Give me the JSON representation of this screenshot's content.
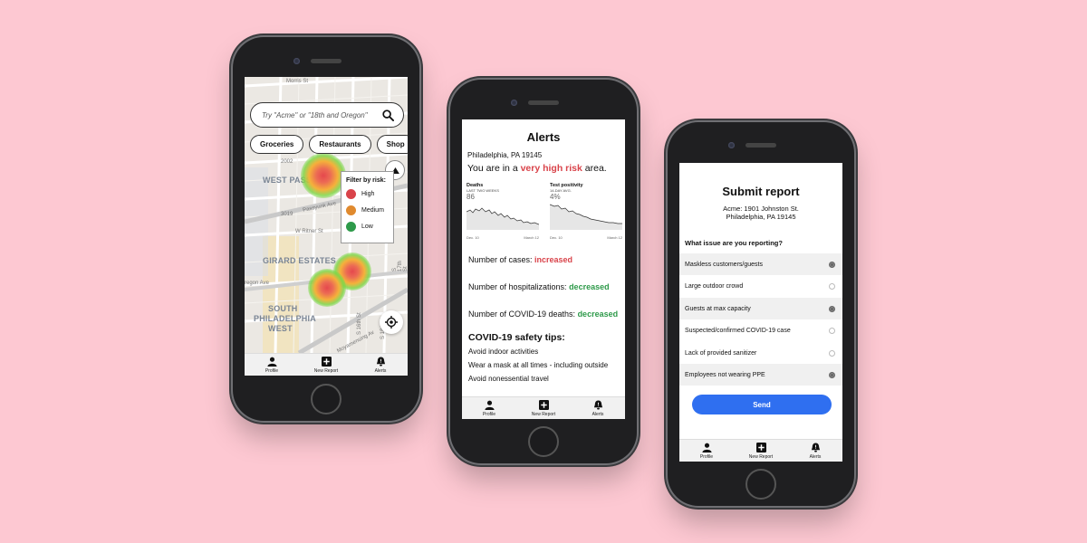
{
  "colors": {
    "background": "#fdc8d2",
    "risk_high": "#d9434a",
    "risk_medium": "#e08a2e",
    "risk_low": "#2e9a4a",
    "primary": "#2f6ff0"
  },
  "tabbar": [
    {
      "label": "Profile",
      "icon": "person-icon"
    },
    {
      "label": "New Report",
      "icon": "plus-square-icon"
    },
    {
      "label": "Alerts",
      "icon": "bell-alert-icon"
    }
  ],
  "map_screen": {
    "search": {
      "placeholder": "Try \"Acme\" or \"18th and Oregon\"",
      "icon": "search-icon"
    },
    "categories": [
      "Groceries",
      "Restaurants",
      "Shop"
    ],
    "filter": {
      "title": "Filter by risk:",
      "levels": [
        {
          "label": "High",
          "color": "#d9434a"
        },
        {
          "label": "Medium",
          "color": "#e08a2e"
        },
        {
          "label": "Low",
          "color": "#2e9a4a"
        }
      ]
    },
    "neighborhoods": [
      "WEST PASSYUNK",
      "GIRARD ESTATES",
      "SOUTH",
      "PHILADELPHIA",
      "WEST"
    ],
    "streets": [
      "Morris St",
      "2002",
      "3019",
      "Passyunk Ave",
      "W Ritner St",
      "regon Ave",
      "S 18th St",
      "S 17th St",
      "S 16th St",
      "Moyamensing Av"
    ],
    "heat_levels": [
      "high",
      "high",
      "high"
    ],
    "buttons": {
      "collapse_icon": "triangle-up-icon",
      "locate_icon": "target-icon"
    }
  },
  "alerts_screen": {
    "title": "Alerts",
    "address": "Philadelphia, PA 19145",
    "risk_prefix": "You are in a ",
    "risk_level": "very high risk",
    "risk_suffix": " area.",
    "charts": [
      {
        "title": "Deaths",
        "subtitle": "LAST TWO WEEKS",
        "value": "86",
        "x_start": "Dec. 10",
        "x_end": "March 12"
      },
      {
        "title": "Test positivity",
        "subtitle": "14-DAY AVG.",
        "value": "4%",
        "x_start": "Dec. 10",
        "x_end": "March 12"
      }
    ],
    "stats": [
      {
        "label": "Number of cases: ",
        "value": "increased",
        "trend": "up"
      },
      {
        "label": "Number of hospitalizations: ",
        "value": "decreased",
        "trend": "down"
      },
      {
        "label": "Number of COVID-19 deaths: ",
        "value": "decreased",
        "trend": "down"
      }
    ],
    "tips_title": "COVID-19 safety tips:",
    "tips": [
      "Avoid indoor activities",
      "Wear a mask at all times - including outside",
      "Avoid nonessential travel"
    ]
  },
  "report_screen": {
    "title": "Submit report",
    "address_line1": "Acme: 1901 Johnston St.",
    "address_line2": "Philadelphia, PA 19145",
    "question": "What issue are you reporting?",
    "options": [
      {
        "label": "Maskless customers/guests",
        "selected": true
      },
      {
        "label": "Large outdoor crowd",
        "selected": false
      },
      {
        "label": "Guests at max capacity",
        "selected": true
      },
      {
        "label": "Suspected/confirmed COVID-19 case",
        "selected": false
      },
      {
        "label": "Lack of provided sanitizer",
        "selected": false
      },
      {
        "label": "Employees not wearing PPE",
        "selected": true
      }
    ],
    "submit_label": "Send"
  }
}
